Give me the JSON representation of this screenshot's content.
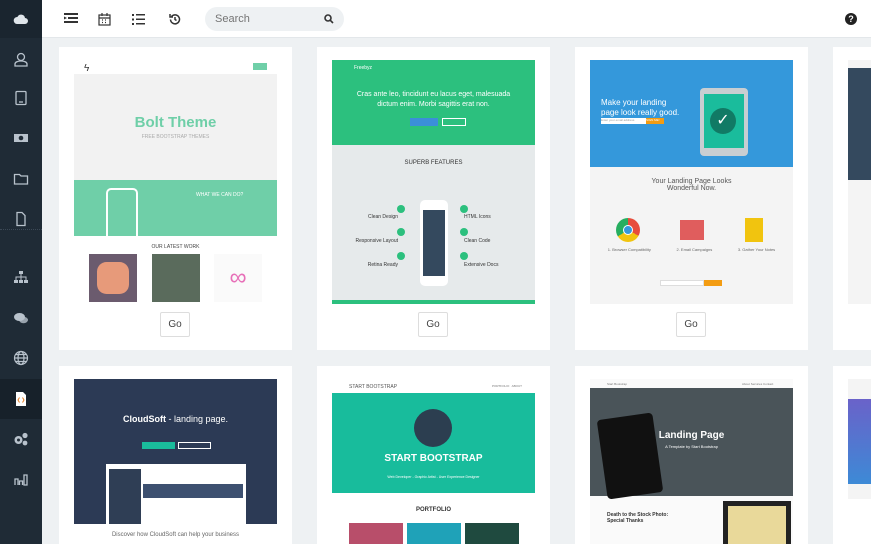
{
  "sidebar": {
    "items": [
      "cloud-icon",
      "user-icon",
      "tablet-icon",
      "money-icon",
      "folder-icon",
      "file-icon",
      "sitemap-icon",
      "comments-icon",
      "globe-icon",
      "code-file-icon",
      "cogs-icon",
      "bar-chart-icon"
    ],
    "active": "code-file-icon"
  },
  "topbar": {
    "search_placeholder": "Search",
    "help": "?"
  },
  "cards": [
    {
      "title": "Bolt Theme",
      "subtitle": "FREE BOOTSTRAP THEMES",
      "section": "WHAT WE CAN DO?",
      "work": "OUR LATEST WORK",
      "go": "Go"
    },
    {
      "brand": "Freebyz",
      "headline": "Cras ante leo, tincidunt eu lacus eget, malesuada dictum enim. Morbi sagittis erat non.",
      "features": "SUPERB FEATURES",
      "left": [
        "Clean Design",
        "Responsive Layout",
        "Retina Ready"
      ],
      "right": [
        "HTML Icons",
        "Clean Code",
        "Extensive Docs"
      ],
      "go": "Go"
    },
    {
      "headline": "Make your landing page look really good.",
      "cta": "SIGN ME!",
      "email": "Enter your email address",
      "title": "Your Landing Page Looks Wonderful Now.",
      "items": [
        "1. Browser Compatibility",
        "2. Email Campaigns",
        "3. Gather Your Notes"
      ],
      "go": "Go"
    },
    {
      "title": "CloudSoft",
      "suffix": " - landing page.",
      "caption": "Discover how CloudSoft can help your business"
    },
    {
      "nav": "START BOOTSTRAP",
      "links": [
        "PORTFOLIO",
        "ABOUT"
      ],
      "title": "START BOOTSTRAP",
      "tagline": "Web Developer - Graphic Artist - User Experience Designer",
      "portfolio": "PORTFOLIO"
    },
    {
      "brand": "Start Bootstrap",
      "links": [
        "About",
        "Services",
        "Contact"
      ],
      "title": "Landing Page",
      "subtitle": "A Template by Start Bootstrap",
      "section": "Death to the Stock Photo: Special Thanks"
    }
  ]
}
